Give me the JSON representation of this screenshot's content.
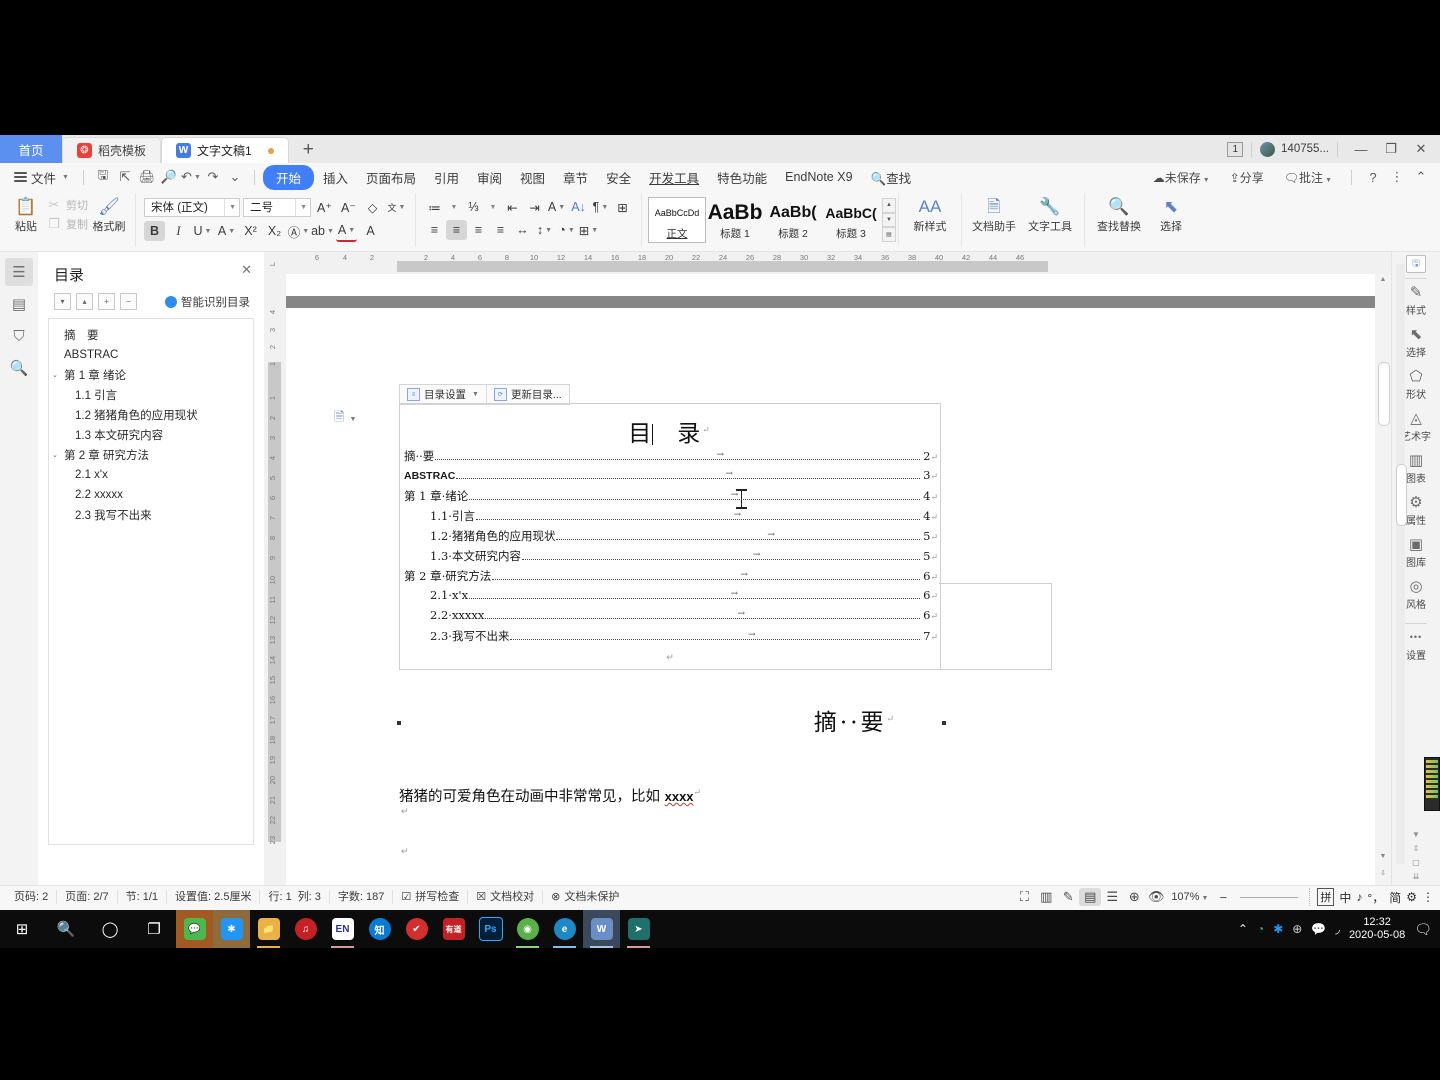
{
  "window": {
    "tabs": [
      {
        "label": "首页",
        "kind": "home"
      },
      {
        "label": "稻壳模板",
        "kind": "inactive",
        "icon": "docer-icon"
      },
      {
        "label": "文字文稿1",
        "kind": "active",
        "icon": "wps-writer-icon"
      }
    ],
    "new_tab": "+",
    "unread_count": "1",
    "account": "140755...",
    "controls": {
      "minimize": "—",
      "maximize": "❐",
      "close": "✕"
    }
  },
  "menubar": {
    "file": "文件",
    "quick_icons": [
      "save-icon",
      "save-as-icon",
      "print-icon",
      "print-preview-icon",
      "undo-icon",
      "redo-icon",
      "customize-icon"
    ],
    "items": [
      {
        "label": "开始",
        "state": "active"
      },
      {
        "label": "插入",
        "state": "normal"
      },
      {
        "label": "页面布局",
        "state": "normal"
      },
      {
        "label": "引用",
        "state": "normal"
      },
      {
        "label": "审阅",
        "state": "normal"
      },
      {
        "label": "视图",
        "state": "normal"
      },
      {
        "label": "章节",
        "state": "normal"
      },
      {
        "label": "安全",
        "state": "normal"
      },
      {
        "label": "开发工具",
        "state": "underline"
      },
      {
        "label": "特色功能",
        "state": "normal"
      },
      {
        "label": "EndNote X9",
        "state": "normal"
      }
    ],
    "search": "查找",
    "right": [
      {
        "label": "未保存",
        "icon": "cloud-icon"
      },
      {
        "label": "分享",
        "icon": "share-icon"
      },
      {
        "label": "批注",
        "icon": "comment-icon"
      }
    ],
    "help": "?",
    "more": "⋮",
    "collapse": "⌃"
  },
  "ribbon": {
    "clipboard": {
      "paste": "粘贴",
      "cut": "剪切",
      "copy": "复制",
      "format_painter": "格式刷"
    },
    "font": {
      "family": "宋体 (正文)",
      "size": "二号",
      "grow": "A⁺",
      "shrink": "A⁻",
      "clear_format": "◇",
      "pinyin": "拼音",
      "bold": "B",
      "italic": "I",
      "underline": "U",
      "strikethrough": "A",
      "superscript": "X²",
      "subscript": "X₂",
      "char_border": "A",
      "highlight": "ab",
      "font_color": "A",
      "char_shading": "A"
    },
    "paragraph": {
      "bullets": "≔",
      "numbering": "⅓",
      "decrease_indent": "⇤",
      "increase_indent": "⇥",
      "asian_layout": "ᴬA",
      "sort": "A↓",
      "show_marks": "¶",
      "table_grid": "⊞",
      "align_left": "≡",
      "align_center": "≡",
      "align_right": "≡",
      "justify": "≡",
      "distribute": "↔",
      "line_spacing": "↕",
      "shading": "◔",
      "borders": "⊞"
    },
    "styles": [
      {
        "preview": "AaBbCcDd",
        "name": "正文",
        "level": "body",
        "selected": true
      },
      {
        "preview": "AaBb",
        "name": "标题 1",
        "level": "h1",
        "selected": false
      },
      {
        "preview": "AaBb(",
        "name": "标题 2",
        "level": "h2",
        "selected": false
      },
      {
        "preview": "AaBbC(",
        "name": "标题 3",
        "level": "h3",
        "selected": false
      }
    ],
    "new_style": "新样式",
    "doc_assistant": "文档助手",
    "text_tools": "文字工具",
    "find_replace": "查找替换",
    "select": "选择"
  },
  "left_icons": [
    {
      "name": "outline-icon",
      "glyph": "☰",
      "active": true
    },
    {
      "name": "thumbnail-icon",
      "glyph": "▤",
      "active": false
    },
    {
      "name": "bookmark-icon",
      "glyph": "🔖",
      "active": false
    },
    {
      "name": "search-doc-icon",
      "glyph": "🔍",
      "active": false
    }
  ],
  "nav_pane": {
    "title": "目录",
    "close": "✕",
    "tools": [
      "▾",
      "▴",
      "+",
      "−"
    ],
    "smart_toc": "智能识别目录",
    "items": [
      {
        "label": "摘　要",
        "indent": 0,
        "expand": ""
      },
      {
        "label": "ABSTRAC",
        "indent": 0,
        "expand": ""
      },
      {
        "label": "第 1 章  绪论",
        "indent": 0,
        "expand": "⌄"
      },
      {
        "label": "1.1  引言",
        "indent": 1,
        "expand": ""
      },
      {
        "label": "1.2  猪猪角色的应用现状",
        "indent": 1,
        "expand": ""
      },
      {
        "label": "1.3  本文研究内容",
        "indent": 1,
        "expand": ""
      },
      {
        "label": "第 2 章  研究方法",
        "indent": 0,
        "expand": "⌄"
      },
      {
        "label": "2.1 x'x",
        "indent": 1,
        "expand": ""
      },
      {
        "label": "2.2 xxxxx",
        "indent": 1,
        "expand": ""
      },
      {
        "label": "2.3  我写不出来",
        "indent": 1,
        "expand": ""
      }
    ]
  },
  "rulers": {
    "horizontal": [
      "6",
      "4",
      "2",
      "2",
      "4",
      "6",
      "8",
      "10",
      "12",
      "14",
      "16",
      "18",
      "20",
      "22",
      "24",
      "26",
      "28",
      "30",
      "32",
      "34",
      "36",
      "38",
      "40",
      "42",
      "44",
      "46"
    ],
    "vertical": [
      "4",
      "3",
      "2",
      "1",
      "1",
      "2",
      "3",
      "4",
      "5",
      "6",
      "7",
      "8",
      "9",
      "10",
      "11",
      "12",
      "13",
      "14",
      "15",
      "16",
      "17",
      "18",
      "19",
      "20",
      "21",
      "22",
      "23"
    ]
  },
  "document": {
    "toc_toolbar": {
      "settings": "目录设置",
      "update": "更新目录..."
    },
    "toc_title": "目　录",
    "toc_entries": [
      {
        "label": "摘··要",
        "page": "2",
        "indent": 0
      },
      {
        "label": "ABSTRAC",
        "page": "3",
        "indent": 0
      },
      {
        "label": "第 1 章·绪论",
        "page": "4",
        "indent": 0
      },
      {
        "label": "1.1·引言",
        "page": "4",
        "indent": 1
      },
      {
        "label": "1.2·猪猪角色的应用现状",
        "page": "5",
        "indent": 1
      },
      {
        "label": "1.3·本文研究内容",
        "page": "5",
        "indent": 1
      },
      {
        "label": "第 2 章·研究方法",
        "page": "6",
        "indent": 0
      },
      {
        "label": "2.1·x'x",
        "page": "6",
        "indent": 1
      },
      {
        "label": "2.2·xxxxx",
        "page": "6",
        "indent": 1
      },
      {
        "label": "2.3·我写不出来",
        "page": "7",
        "indent": 1
      }
    ],
    "abstract_heading": "摘··要",
    "abstract_body": "猪猪的可爱角色在动画中非常常见，比如 ",
    "abstract_body_misspelled": "xxxx",
    "pilcrow": "↵"
  },
  "right_panel": {
    "items": [
      {
        "label": "样式",
        "icon": "style-icon",
        "glyph": "✎"
      },
      {
        "label": "选择",
        "icon": "select-arrow-icon",
        "glyph": "⬉"
      },
      {
        "label": "形状",
        "icon": "shape-icon",
        "glyph": "⬠"
      },
      {
        "label": "艺术字",
        "icon": "wordart-icon",
        "glyph": "◬"
      },
      {
        "label": "图表",
        "icon": "chart-icon",
        "glyph": "📊"
      },
      {
        "label": "属性",
        "icon": "properties-icon",
        "glyph": "⚙"
      },
      {
        "label": "图库",
        "icon": "gallery-icon",
        "glyph": "🖼"
      },
      {
        "label": "风格",
        "icon": "style-theme-icon",
        "glyph": "◎"
      }
    ],
    "settings": "设置"
  },
  "status_bar": {
    "left": [
      {
        "label": "页码: 2",
        "name": "page-number"
      },
      {
        "label": "页面: 2/7",
        "name": "page-count"
      },
      {
        "label": "节: 1/1",
        "name": "section"
      },
      {
        "label": "设置值: 2.5厘米",
        "name": "margin-value"
      },
      {
        "label": "行: 1",
        "name": "line"
      },
      {
        "label": "列: 3",
        "name": "column"
      },
      {
        "label": "字数: 187",
        "name": "word-count"
      }
    ],
    "spell_check": "拼写检查",
    "doc_proof": "文档校对",
    "doc_unprotected": "文档未保护",
    "view_buttons": [
      "fullscreen-icon",
      "two-page-icon",
      "edit-icon",
      "page-view-icon",
      "outline-view-icon",
      "web-view-icon",
      "eye-protect-icon"
    ],
    "zoom": "107%",
    "zoom_out": "−",
    "ime": [
      "拼",
      "中",
      "♪",
      "°，",
      "简",
      "⚙",
      "⋮"
    ]
  },
  "taskbar": {
    "start": "⊞",
    "search": "🔍",
    "cortana": "◯",
    "taskview": "❐",
    "apps": [
      {
        "name": "wechat-taskbar-icon",
        "glyph": "💬",
        "color": "#4eb84e",
        "highlight": true
      },
      {
        "name": "star-app-icon",
        "glyph": "✱",
        "color": "#2196f3",
        "highlight": true
      },
      {
        "name": "file-explorer-icon",
        "glyph": "📁",
        "color": "#e9b248"
      },
      {
        "name": "netease-music-icon",
        "glyph": "♫",
        "color": "#c42127"
      },
      {
        "name": "endnote-icon",
        "glyph": "EN",
        "color": "#ffffff"
      },
      {
        "name": "zhihu-icon",
        "glyph": "知",
        "color": "#0a7bd3"
      },
      {
        "name": "checkmark-app-icon",
        "glyph": "✔",
        "color": "#d32f2f"
      },
      {
        "name": "youdao-icon",
        "glyph": "有道",
        "color": "#c42127"
      },
      {
        "name": "photoshop-icon",
        "glyph": "Ps",
        "color": "#001e36"
      },
      {
        "name": "browser-green-icon",
        "glyph": "◉",
        "color": "#5bb04a"
      },
      {
        "name": "edge-icon",
        "glyph": "e",
        "color": "#1e88c7"
      },
      {
        "name": "wps-icon",
        "glyph": "W",
        "color": "#6b8fc4"
      },
      {
        "name": "app-teal-icon",
        "glyph": "➤",
        "color": "#1f6f6a"
      }
    ],
    "tray_up": "⌃",
    "tray": [
      {
        "name": "wps-cloud-tray-icon",
        "glyph": "◔",
        "color": "#3aa76d"
      },
      {
        "name": "star-tray-icon",
        "glyph": "✱",
        "color": "#2196f3"
      },
      {
        "name": "globe-tray-icon",
        "glyph": "⊕",
        "color": "#cccccc"
      },
      {
        "name": "wechat-tray-icon",
        "glyph": "💬",
        "color": "#4eb84e"
      },
      {
        "name": "wifi-icon",
        "glyph": "◞",
        "color": "#dddddd"
      }
    ],
    "time": "12:32",
    "date": "2020-05-08",
    "notifications": "notification-icon"
  }
}
